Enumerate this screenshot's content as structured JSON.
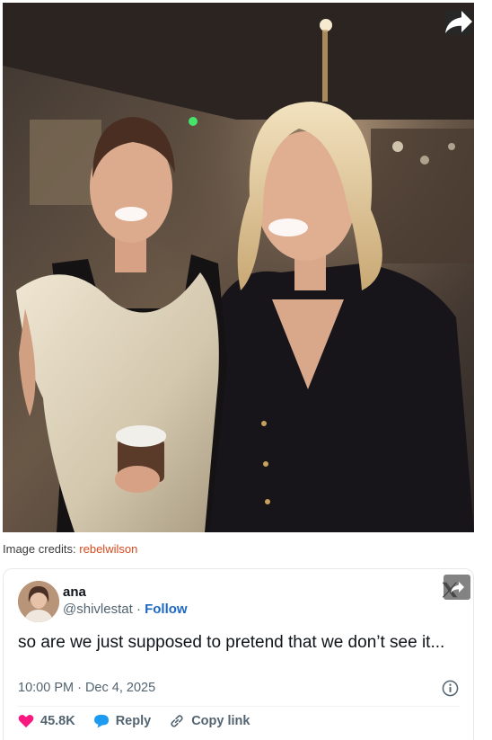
{
  "photo": {
    "alt": "Two women smiling together at an indoor event",
    "share_icon": "share-arrow-icon"
  },
  "credits": {
    "label": "Image credits:",
    "source": "rebelwilson"
  },
  "tweet": {
    "author_name": "ana",
    "handle": "@shivlestat",
    "separator": "·",
    "follow_label": "Follow",
    "text": "so are we just supposed to pretend that we don’t see it...",
    "timestamp": "10:00 PM · Dec 4, 2025",
    "likes": "45.8K",
    "reply_label": "Reply",
    "copy_link_label": "Copy link",
    "icons": [
      "x-logo-icon",
      "share-arrow-icon",
      "info-icon",
      "heart-icon",
      "reply-bubble-icon",
      "link-icon"
    ],
    "colors": {
      "heart": "#f91880",
      "reply": "#1d9bf0",
      "follow": "#1d68c2",
      "credit_link": "#d94a1e"
    }
  }
}
